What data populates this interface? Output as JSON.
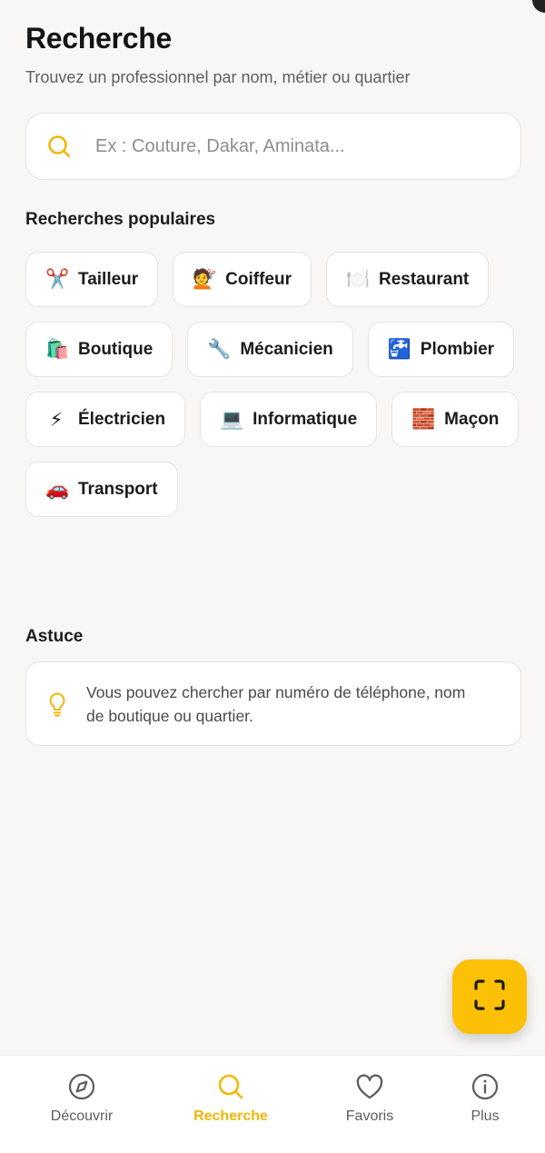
{
  "header": {
    "title": "Recherche",
    "subtitle": "Trouvez un professionnel par nom, métier ou quartier"
  },
  "search": {
    "icon": "search-icon",
    "placeholder": "Ex : Couture, Dakar, Aminata..."
  },
  "popular": {
    "title": "Recherches populaires",
    "items": [
      {
        "emoji": "✂️",
        "icon": "scissors-icon",
        "label": "Tailleur"
      },
      {
        "emoji": "💇",
        "icon": "haircut-icon",
        "label": "Coiffeur"
      },
      {
        "emoji": "🍽️",
        "icon": "plate-icon",
        "label": "Restaurant"
      },
      {
        "emoji": "🛍️",
        "icon": "shopping-bags-icon",
        "label": "Boutique"
      },
      {
        "emoji": "🔧",
        "icon": "wrench-icon",
        "label": "Mécanicien"
      },
      {
        "emoji": "🚰",
        "icon": "water-tap-icon",
        "label": "Plombier"
      },
      {
        "emoji": "⚡",
        "icon": "lightning-icon",
        "label": "Électricien"
      },
      {
        "emoji": "💻",
        "icon": "laptop-icon",
        "label": "Informatique"
      },
      {
        "emoji": "🧱",
        "icon": "brick-icon",
        "label": "Maçon"
      },
      {
        "emoji": "🚗",
        "icon": "car-icon",
        "label": "Transport"
      }
    ]
  },
  "tip": {
    "title": "Astuce",
    "icon": "lightbulb-icon",
    "text": "Vous pouvez chercher par numéro de téléphone, nom de boutique ou quartier."
  },
  "fab": {
    "icon": "scan-icon"
  },
  "tabbar": {
    "items": [
      {
        "label": "Découvrir",
        "icon": "compass-icon",
        "active": false
      },
      {
        "label": "Recherche",
        "icon": "search-icon",
        "active": true
      },
      {
        "label": "Favoris",
        "icon": "heart-icon",
        "active": false
      },
      {
        "label": "Plus",
        "icon": "info-icon",
        "active": false
      }
    ]
  },
  "colors": {
    "accent": "#fcc006",
    "accent_text": "#f2b705",
    "background": "#f8f7f5"
  }
}
